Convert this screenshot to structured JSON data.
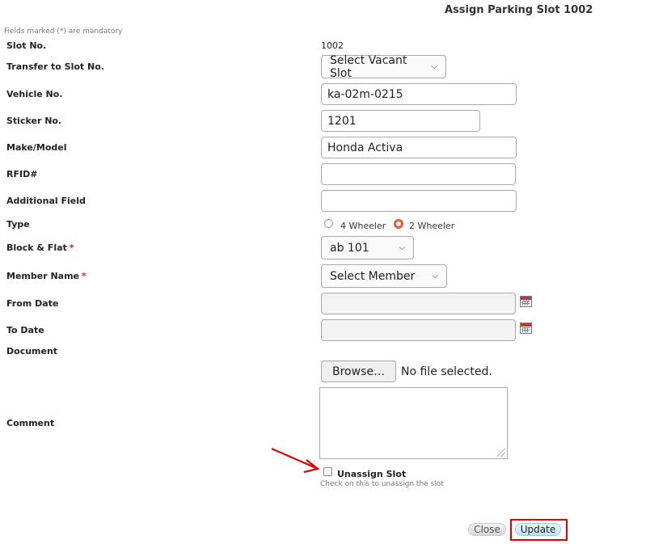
{
  "page": {
    "title": "Assign Parking Slot 1002",
    "mandatory_note": "Fields marked (*) are mandatory"
  },
  "form": {
    "slot_no": {
      "label": "Slot No.",
      "value": "1002"
    },
    "transfer": {
      "label": "Transfer to Slot No.",
      "selected": "Select Vacant Slot"
    },
    "vehicle_no": {
      "label": "Vehicle No.",
      "value": "ka-02m-0215"
    },
    "sticker_no": {
      "label": "Sticker No.",
      "value": "1201"
    },
    "make_model": {
      "label": "Make/Model",
      "value": "Honda Activa"
    },
    "rfid": {
      "label": "RFID#",
      "value": ""
    },
    "additional": {
      "label": "Additional Field",
      "value": ""
    },
    "type": {
      "label": "Type",
      "options": [
        "4 Wheeler",
        "2 Wheeler"
      ],
      "selected": "2 Wheeler"
    },
    "block_flat": {
      "label": "Block & Flat",
      "required_mark": "*",
      "selected": "ab 101"
    },
    "member_name": {
      "label": "Member Name",
      "required_mark": "*",
      "selected": "Select Member"
    },
    "from_date": {
      "label": "From Date",
      "value": ""
    },
    "to_date": {
      "label": "To Date",
      "value": ""
    },
    "document": {
      "label": "Document",
      "browse_label": "Browse…",
      "file_status": "No file selected."
    },
    "comment": {
      "label": "Comment",
      "value": ""
    },
    "unassign": {
      "label": "Unassign Slot",
      "hint": "Check on this to unassign the slot",
      "checked": false
    }
  },
  "actions": {
    "close_label": "Close",
    "update_label": "Update"
  },
  "icons": {
    "select_chevron": "chevron-down-icon",
    "date_picker": "calendar-icon",
    "annotation": "red-arrow-icon"
  },
  "colors": {
    "required": "#dd2222",
    "radio_selected": "#e55b3c",
    "highlight": "#e00000",
    "update_button": "#bfe3f1"
  }
}
